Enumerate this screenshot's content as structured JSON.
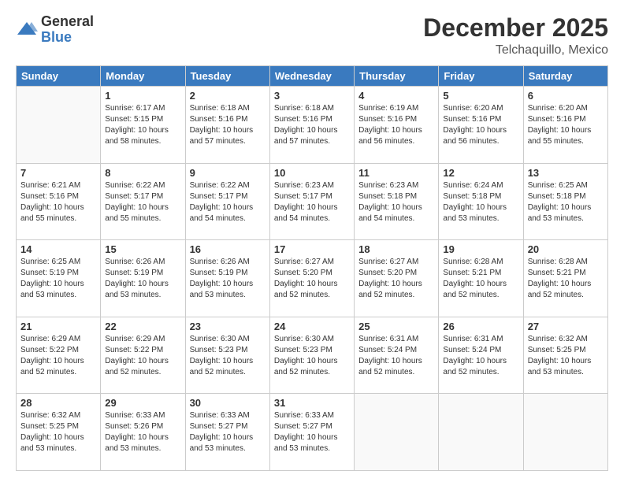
{
  "header": {
    "logo_general": "General",
    "logo_blue": "Blue",
    "month_title": "December 2025",
    "location": "Telchaquillo, Mexico"
  },
  "days_of_week": [
    "Sunday",
    "Monday",
    "Tuesday",
    "Wednesday",
    "Thursday",
    "Friday",
    "Saturday"
  ],
  "weeks": [
    [
      {
        "day": "",
        "sunrise": "",
        "sunset": "",
        "daylight": "",
        "empty": true
      },
      {
        "day": "1",
        "sunrise": "6:17 AM",
        "sunset": "5:15 PM",
        "daylight": "10 hours and 58 minutes."
      },
      {
        "day": "2",
        "sunrise": "6:18 AM",
        "sunset": "5:16 PM",
        "daylight": "10 hours and 57 minutes."
      },
      {
        "day": "3",
        "sunrise": "6:18 AM",
        "sunset": "5:16 PM",
        "daylight": "10 hours and 57 minutes."
      },
      {
        "day": "4",
        "sunrise": "6:19 AM",
        "sunset": "5:16 PM",
        "daylight": "10 hours and 56 minutes."
      },
      {
        "day": "5",
        "sunrise": "6:20 AM",
        "sunset": "5:16 PM",
        "daylight": "10 hours and 56 minutes."
      },
      {
        "day": "6",
        "sunrise": "6:20 AM",
        "sunset": "5:16 PM",
        "daylight": "10 hours and 55 minutes."
      }
    ],
    [
      {
        "day": "7",
        "sunrise": "6:21 AM",
        "sunset": "5:16 PM",
        "daylight": "10 hours and 55 minutes."
      },
      {
        "day": "8",
        "sunrise": "6:22 AM",
        "sunset": "5:17 PM",
        "daylight": "10 hours and 55 minutes."
      },
      {
        "day": "9",
        "sunrise": "6:22 AM",
        "sunset": "5:17 PM",
        "daylight": "10 hours and 54 minutes."
      },
      {
        "day": "10",
        "sunrise": "6:23 AM",
        "sunset": "5:17 PM",
        "daylight": "10 hours and 54 minutes."
      },
      {
        "day": "11",
        "sunrise": "6:23 AM",
        "sunset": "5:18 PM",
        "daylight": "10 hours and 54 minutes."
      },
      {
        "day": "12",
        "sunrise": "6:24 AM",
        "sunset": "5:18 PM",
        "daylight": "10 hours and 53 minutes."
      },
      {
        "day": "13",
        "sunrise": "6:25 AM",
        "sunset": "5:18 PM",
        "daylight": "10 hours and 53 minutes."
      }
    ],
    [
      {
        "day": "14",
        "sunrise": "6:25 AM",
        "sunset": "5:19 PM",
        "daylight": "10 hours and 53 minutes."
      },
      {
        "day": "15",
        "sunrise": "6:26 AM",
        "sunset": "5:19 PM",
        "daylight": "10 hours and 53 minutes."
      },
      {
        "day": "16",
        "sunrise": "6:26 AM",
        "sunset": "5:19 PM",
        "daylight": "10 hours and 53 minutes."
      },
      {
        "day": "17",
        "sunrise": "6:27 AM",
        "sunset": "5:20 PM",
        "daylight": "10 hours and 52 minutes."
      },
      {
        "day": "18",
        "sunrise": "6:27 AM",
        "sunset": "5:20 PM",
        "daylight": "10 hours and 52 minutes."
      },
      {
        "day": "19",
        "sunrise": "6:28 AM",
        "sunset": "5:21 PM",
        "daylight": "10 hours and 52 minutes."
      },
      {
        "day": "20",
        "sunrise": "6:28 AM",
        "sunset": "5:21 PM",
        "daylight": "10 hours and 52 minutes."
      }
    ],
    [
      {
        "day": "21",
        "sunrise": "6:29 AM",
        "sunset": "5:22 PM",
        "daylight": "10 hours and 52 minutes."
      },
      {
        "day": "22",
        "sunrise": "6:29 AM",
        "sunset": "5:22 PM",
        "daylight": "10 hours and 52 minutes."
      },
      {
        "day": "23",
        "sunrise": "6:30 AM",
        "sunset": "5:23 PM",
        "daylight": "10 hours and 52 minutes."
      },
      {
        "day": "24",
        "sunrise": "6:30 AM",
        "sunset": "5:23 PM",
        "daylight": "10 hours and 52 minutes."
      },
      {
        "day": "25",
        "sunrise": "6:31 AM",
        "sunset": "5:24 PM",
        "daylight": "10 hours and 52 minutes."
      },
      {
        "day": "26",
        "sunrise": "6:31 AM",
        "sunset": "5:24 PM",
        "daylight": "10 hours and 52 minutes."
      },
      {
        "day": "27",
        "sunrise": "6:32 AM",
        "sunset": "5:25 PM",
        "daylight": "10 hours and 53 minutes."
      }
    ],
    [
      {
        "day": "28",
        "sunrise": "6:32 AM",
        "sunset": "5:25 PM",
        "daylight": "10 hours and 53 minutes."
      },
      {
        "day": "29",
        "sunrise": "6:33 AM",
        "sunset": "5:26 PM",
        "daylight": "10 hours and 53 minutes."
      },
      {
        "day": "30",
        "sunrise": "6:33 AM",
        "sunset": "5:27 PM",
        "daylight": "10 hours and 53 minutes."
      },
      {
        "day": "31",
        "sunrise": "6:33 AM",
        "sunset": "5:27 PM",
        "daylight": "10 hours and 53 minutes."
      },
      {
        "day": "",
        "sunrise": "",
        "sunset": "",
        "daylight": "",
        "empty": true
      },
      {
        "day": "",
        "sunrise": "",
        "sunset": "",
        "daylight": "",
        "empty": true
      },
      {
        "day": "",
        "sunrise": "",
        "sunset": "",
        "daylight": "",
        "empty": true
      }
    ]
  ],
  "labels": {
    "sunrise": "Sunrise:",
    "sunset": "Sunset:",
    "daylight": "Daylight:"
  }
}
